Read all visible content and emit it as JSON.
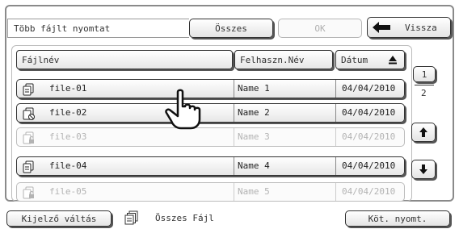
{
  "header": {
    "title": "Több fájlt nyomtat",
    "all_label": "Összes",
    "ok_label": "OK",
    "back_label": "Vissza"
  },
  "columns": {
    "filename": "Fájlnév",
    "username": "Felhaszn.Név",
    "date": "Dátum"
  },
  "rows": [
    {
      "icon": "print-job-icon",
      "filename": "file-01",
      "user": "Name 1",
      "date": "04/04/2010",
      "enabled": true
    },
    {
      "icon": "print-job-blocked-icon",
      "filename": "file-02",
      "user": "Name 2",
      "date": "04/04/2010",
      "enabled": true
    },
    {
      "icon": "print-job-locked-icon",
      "filename": "file-03",
      "user": "Name 3",
      "date": "04/04/2010",
      "enabled": false
    },
    {
      "icon": "print-job-icon",
      "filename": "file-04",
      "user": "Name 4",
      "date": "04/04/2010",
      "enabled": true
    },
    {
      "icon": "print-job-locked-icon",
      "filename": "file-05",
      "user": "Name 5",
      "date": "04/04/2010",
      "enabled": false
    }
  ],
  "pager": {
    "current_page": "1",
    "total_pages": "2"
  },
  "footer": {
    "display_switch_label": "Kijelző váltás",
    "all_files_label": "Összes Fájl",
    "batch_print_label": "Köt. nyomt."
  }
}
